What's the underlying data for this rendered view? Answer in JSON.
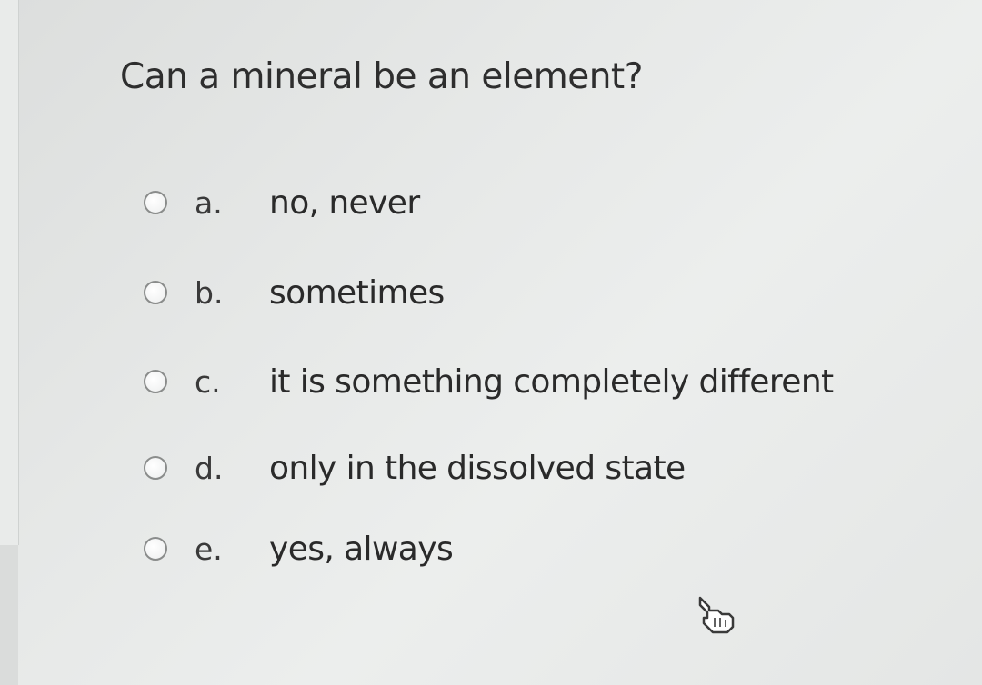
{
  "question": {
    "text": "Can a mineral be an element?"
  },
  "options": [
    {
      "letter": "a.",
      "text": "no, never"
    },
    {
      "letter": "b.",
      "text": "sometimes"
    },
    {
      "letter": "c.",
      "text": "it is something completely different"
    },
    {
      "letter": "d.",
      "text": "only in the dissolved state"
    },
    {
      "letter": "e.",
      "text": "yes, always"
    }
  ],
  "selected": null,
  "icons": {
    "radio": "radio-unchecked-icon",
    "cursor": "hand-pointer-cursor-icon"
  }
}
